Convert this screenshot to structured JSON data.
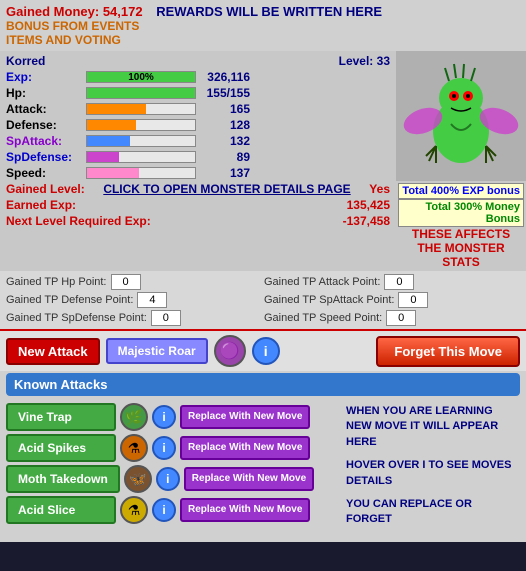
{
  "header": {
    "gained_money_label": "Gained Money:",
    "gained_money_value": "54,172",
    "rewards_label": "REWARDS WILL BE WRITTEN HERE",
    "bonus_events": "BONUS FROM EVENTS",
    "items_voting": "ITEMS AND VOTING"
  },
  "player": {
    "name": "Korred",
    "level_label": "Level:",
    "level_value": "33",
    "exp_label": "Exp:",
    "exp_value": "326,116",
    "exp_pct": 100,
    "hp_label": "Hp:",
    "hp_value": "155/155",
    "hp_pct": 100,
    "attack_label": "Attack:",
    "attack_value": "165",
    "attack_pct": 55,
    "defense_label": "Defense:",
    "defense_value": "128",
    "defense_pct": 45,
    "sp_attack_label": "SpAttack:",
    "sp_attack_value": "132",
    "sp_attack_pct": 40,
    "sp_defense_label": "SpDefense:",
    "sp_defense_value": "89",
    "sp_defense_pct": 30,
    "speed_label": "Speed:",
    "speed_value": "137",
    "speed_pct": 48,
    "gained_level_label": "Gained Level:",
    "gained_level_value": "Yes",
    "earned_exp_label": "Earned Exp:",
    "earned_exp_value": "135,425",
    "next_level_label": "Next Level Required Exp:",
    "next_level_value": "-137,458"
  },
  "bonuses": {
    "exp_bonus": "Total 400% EXP bonus",
    "money_bonus": "Total 300% Money",
    "bonus_label": "Bonus",
    "affects_label": "THESE AFFECTS",
    "affects_label2": "THE MONSTER",
    "stats_label": "STATS"
  },
  "click_open": "CLICK TO OPEN MONSTER DETAILS PAGE",
  "tp_points": {
    "hp_label": "Gained TP Hp Point:",
    "hp_value": "0",
    "defense_label": "Gained TP Defense Point:",
    "defense_value": "4",
    "sp_defense_label": "Gained TP SpDefense Point:",
    "sp_defense_value": "0",
    "attack_label": "Gained TP Attack Point:",
    "attack_value": "0",
    "sp_attack_label": "Gained TP SpAttack Point:",
    "sp_attack_value": "0",
    "speed_label": "Gained TP Speed Point:",
    "speed_value": "0"
  },
  "attack_bar": {
    "new_attack_label": "New Attack",
    "move_name": "Majestic Roar",
    "forget_label": "Forget This Move"
  },
  "known_attacks": {
    "header": "Known Attacks",
    "info_texts": [
      "WHEN YOU ARE LEARNING NEW MOVE IT WILL APPEAR HERE",
      "HOVER OVER I TO SEE MOVES DETAILS",
      "YOU CAN REPLACE OR FORGET"
    ],
    "attacks": [
      {
        "name": "Vine Trap",
        "icon": "🌿",
        "icon_type": "green2"
      },
      {
        "name": "Acid Spikes",
        "icon": "⚗",
        "icon_type": "orange"
      },
      {
        "name": "Moth Takedown",
        "icon": "🦋",
        "icon_type": "brown"
      },
      {
        "name": "Acid Slice",
        "icon": "⚗",
        "icon_type": "yellow"
      }
    ],
    "replace_label": "Replace With New Move"
  }
}
